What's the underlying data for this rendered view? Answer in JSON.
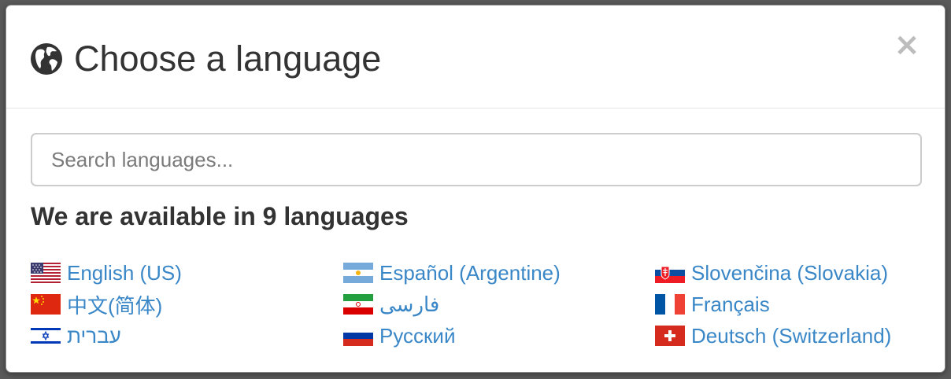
{
  "dialog": {
    "title": "Choose a language",
    "title_icon": "globe-icon",
    "close_label": "×",
    "close_icon": "close-icon"
  },
  "search": {
    "placeholder": "Search languages...",
    "value": ""
  },
  "availability_text": "We are available in 9 languages",
  "link_color": "#3a87c8",
  "languages": [
    {
      "label": "English (US)",
      "flag": "us-flag-icon"
    },
    {
      "label": "Español (Argentine)",
      "flag": "argentina-flag-icon"
    },
    {
      "label": "Slovenčina (Slovakia)",
      "flag": "slovakia-flag-icon"
    },
    {
      "label": "中文(简体)",
      "flag": "china-flag-icon"
    },
    {
      "label": "فارسی",
      "flag": "iran-flag-icon"
    },
    {
      "label": "Français",
      "flag": "france-flag-icon"
    },
    {
      "label": "עברית",
      "flag": "israel-flag-icon"
    },
    {
      "label": "Русский",
      "flag": "russia-flag-icon"
    },
    {
      "label": "Deutsch (Switzerland)",
      "flag": "switzerland-flag-icon"
    }
  ]
}
